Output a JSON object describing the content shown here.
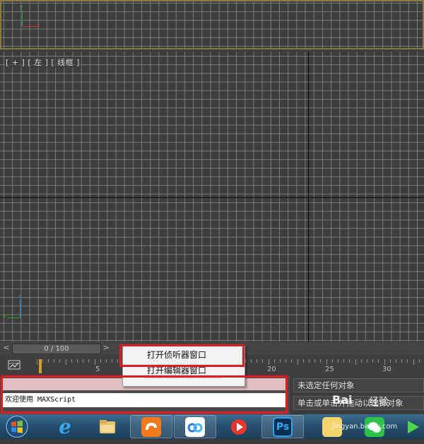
{
  "viewport_top": {
    "gizmo": {
      "y": "y",
      "z": "z",
      "x": "x"
    }
  },
  "viewport_main": {
    "label": "[ + ] [ 左 ] [ 线框 ]",
    "gizmo": {
      "z": "z",
      "x": "x"
    }
  },
  "time_slider": {
    "prev": "<",
    "next": ">",
    "value": "0 / 100"
  },
  "ruler": {
    "labels": [
      "5",
      "20",
      "25",
      "30"
    ]
  },
  "context_menu": {
    "items": [
      "打开侦听器窗口",
      "打开编辑器窗口"
    ]
  },
  "maxscript": {
    "input_text": "欢迎使用 MAXScript"
  },
  "status": {
    "line1": "未选定任何对象",
    "line2": "单击或单击并拖动以选择对象"
  },
  "taskbar": {
    "apps": [
      "start",
      "internet-explorer",
      "file-explorer",
      "uc-browser",
      "baidu-netdisk",
      "video-player",
      "photoshop",
      "sticky-notes",
      "wechat",
      "media"
    ],
    "ps_label": "Ps",
    "ie_label": "e"
  },
  "watermark": {
    "brand": "Bai",
    "text": "经验",
    "url": "jingyan.baidu.com"
  },
  "colors": {
    "highlight": "#e11b22",
    "viewport_bg": "#3d3d3d",
    "active_border": "#8a7a45"
  }
}
